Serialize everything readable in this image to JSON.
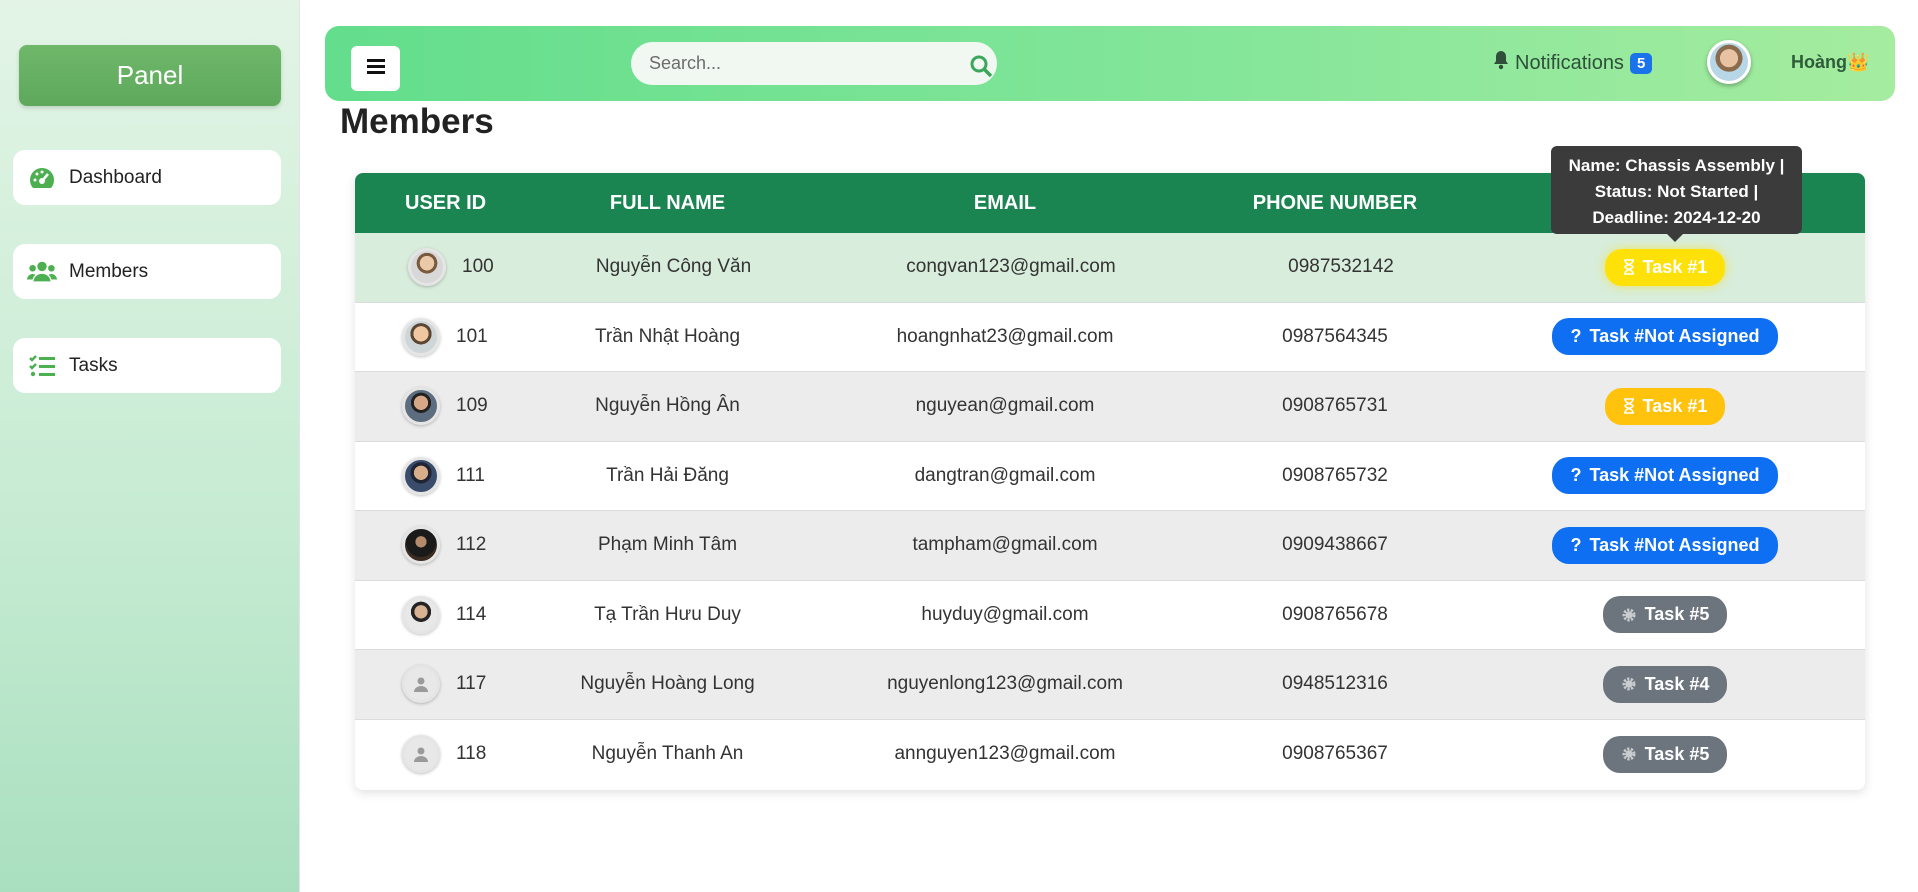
{
  "sidebar": {
    "panel_label": "Panel",
    "items": [
      {
        "label": "Dashboard",
        "icon": "gauge-icon"
      },
      {
        "label": "Members",
        "icon": "users-icon"
      },
      {
        "label": "Tasks",
        "icon": "list-check-icon"
      }
    ]
  },
  "topbar": {
    "search_placeholder": "Search...",
    "notifications_label": "Notifications",
    "notifications_count": "5",
    "username": "Hoàng",
    "crown": "👑"
  },
  "page": {
    "title": "Members"
  },
  "table": {
    "headers": [
      "USER ID",
      "FULL NAME",
      "EMAIL",
      "PHONE NUMBER"
    ],
    "rows": [
      {
        "id": "100",
        "name": "Nguyễn Công Văn",
        "email": "congvan123@gmail.com",
        "phone": "0987532142",
        "task": "Task #1"
      },
      {
        "id": "101",
        "name": "Trần Nhật Hoàng",
        "email": "hoangnhat23@gmail.com",
        "phone": "0987564345",
        "task": "Task #Not Assigned"
      },
      {
        "id": "109",
        "name": "Nguyễn Hồng Ân",
        "email": "nguyean@gmail.com",
        "phone": "0908765731",
        "task": "Task #1"
      },
      {
        "id": "111",
        "name": "Trần Hải Đăng",
        "email": "dangtran@gmail.com",
        "phone": "0908765732",
        "task": "Task #Not Assigned"
      },
      {
        "id": "112",
        "name": "Phạm Minh Tâm",
        "email": "tampham@gmail.com",
        "phone": "0909438667",
        "task": "Task #Not Assigned"
      },
      {
        "id": "114",
        "name": "Tạ Trần Hưu Duy",
        "email": "huyduy@gmail.com",
        "phone": "0908765678",
        "task": "Task #5"
      },
      {
        "id": "117",
        "name": "Nguyễn Hoàng Long",
        "email": "nguyenlong123@gmail.com",
        "phone": "0948512316",
        "task": "Task #4"
      },
      {
        "id": "118",
        "name": "Nguyễn Thanh An",
        "email": "annguyen123@gmail.com",
        "phone": "0908765367",
        "task": "Task #5"
      }
    ]
  },
  "tooltip": {
    "line1": "Name: Chassis Assembly |",
    "line2": "Status: Not Started |",
    "line3": "Deadline: 2024-12-20"
  },
  "colors": {
    "header_green": "#1b8552",
    "task_in_progress": "#ffc20d",
    "task_not_assigned": "#0f6ff2",
    "task_other": "#6c757d"
  }
}
